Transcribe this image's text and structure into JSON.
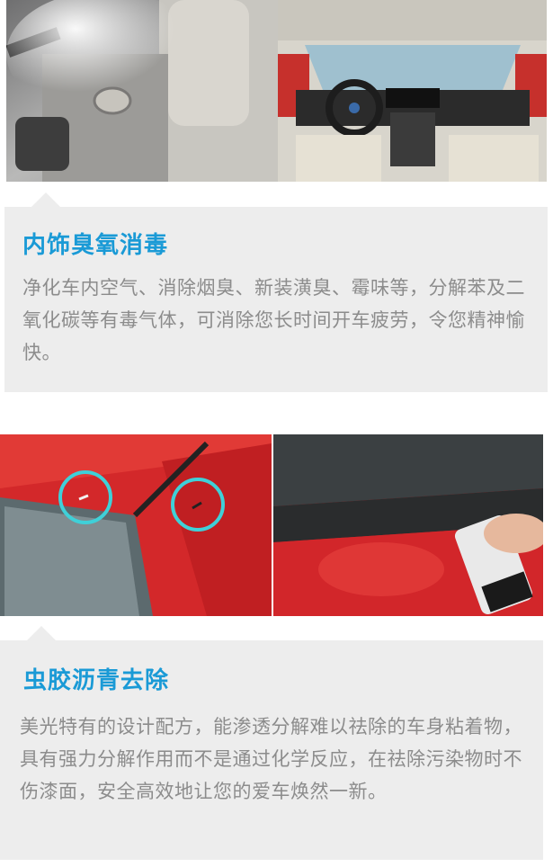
{
  "sections": [
    {
      "title": "内饰臭氧消毒",
      "body": "净化车内空气、消除烟臭、新装潢臭、霉味等，分解苯及二氧化碳等有毒气体，可消除您长时间开车疲劳，令您精神愉快。",
      "images": [
        "steam-cleaning-door-photo",
        "car-interior-dashboard-photo"
      ]
    },
    {
      "title": "虫胶沥青去除",
      "body": "美光特有的设计配方，能渗透分解难以祛除的车身粘着物，具有强力分解作用而不是通过化学反应，在祛除污染物时不伤漆面，安全高效地让您的爱车焕然一新。",
      "images": [
        "red-car-stain-circles-photo",
        "spray-can-on-red-car-photo"
      ]
    }
  ],
  "colors": {
    "title_blue": "#1a9ad6",
    "body_gray": "#8c8c8c",
    "card_bg": "#ededed",
    "circle_cyan": "#3fd0d8"
  }
}
